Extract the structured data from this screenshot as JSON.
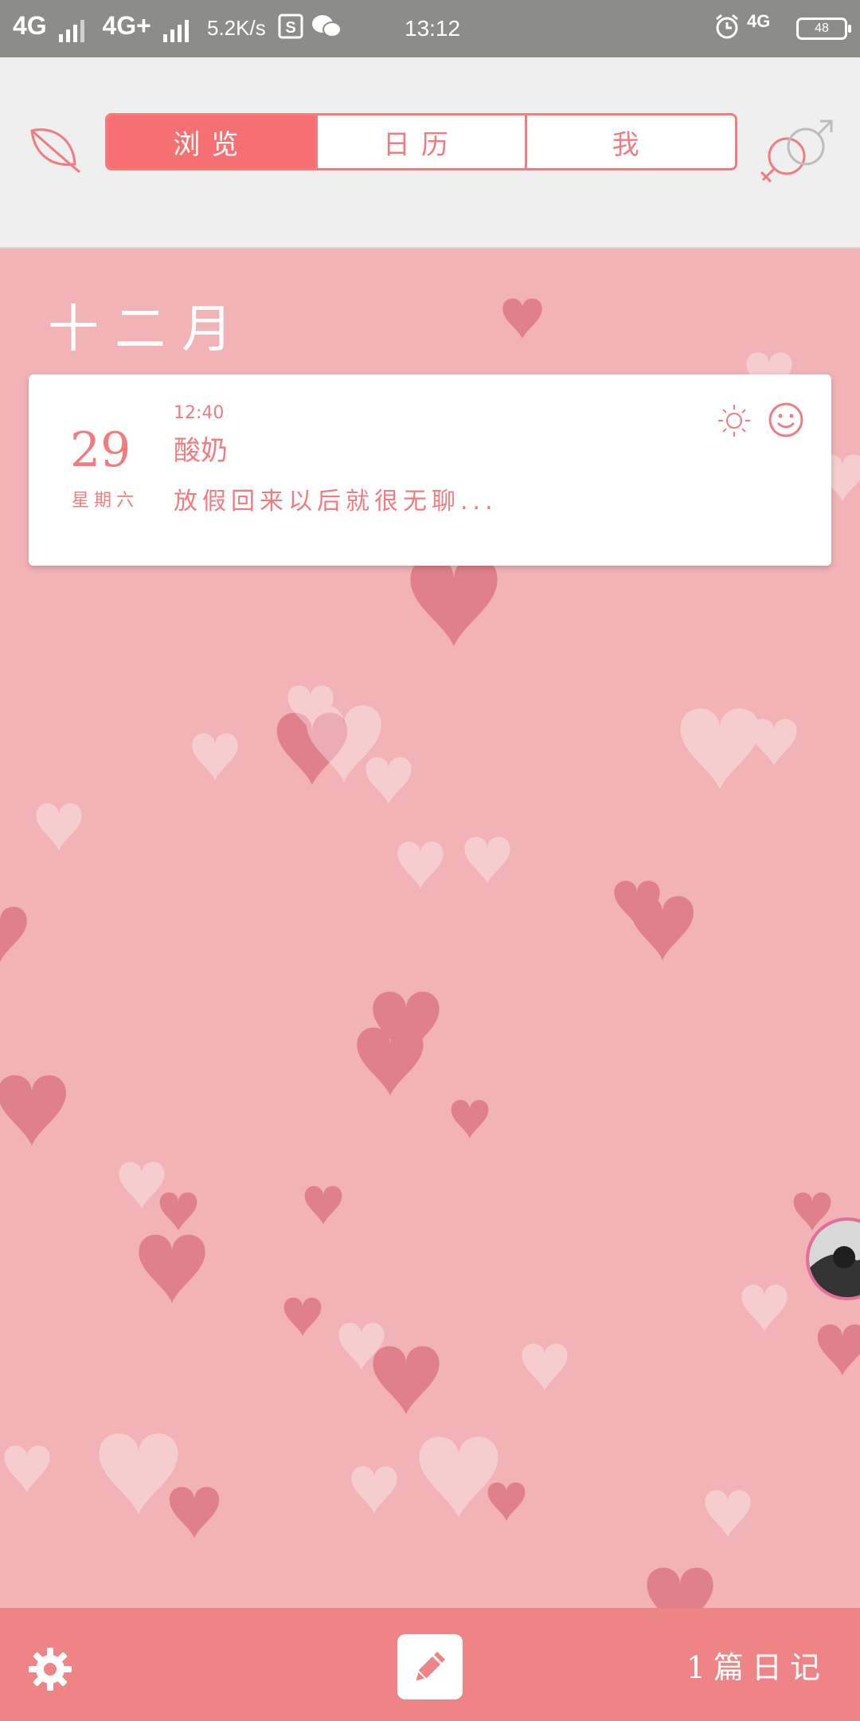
{
  "status_bar": {
    "network1": "4G",
    "network2": "4G+",
    "speed": "5.2K/s",
    "time": "13:12",
    "network3": "4G",
    "battery": "48"
  },
  "nav": {
    "tabs": [
      "浏览",
      "日历",
      "我"
    ],
    "active_tab": 0
  },
  "main": {
    "month": "十二月"
  },
  "entry": {
    "day": "29",
    "weekday": "星期六",
    "time": "12:40",
    "title": "酸奶",
    "excerpt": "放假回来以后就很无聊..."
  },
  "bottom": {
    "count": "1篇日记"
  },
  "icons": {
    "leaf": "leaf-icon",
    "gender": "gender-icon",
    "weather": "sun-icon",
    "mood": "smile-icon",
    "settings": "gear-icon",
    "compose": "pencil-icon"
  },
  "colors": {
    "accent": "#f56f73",
    "background": "#f2b3b6",
    "bottom_bar": "#ef8486"
  }
}
